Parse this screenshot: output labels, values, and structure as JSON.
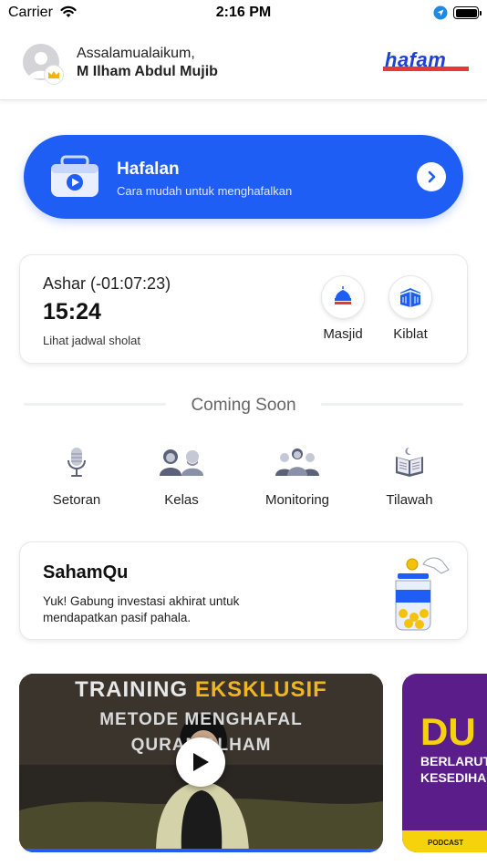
{
  "status_bar": {
    "carrier": "Carrier",
    "time": "2:16 PM"
  },
  "header": {
    "greeting": "Assalamualaikum,",
    "username": "M Ilham Abdul Mujib",
    "logo_text": "hafam"
  },
  "hafalan": {
    "title": "Hafalan",
    "subtitle": "Cara mudah untuk menghafalkan"
  },
  "prayer": {
    "name": "Ashar (-01:07:23)",
    "time": "15:24",
    "schedule_link": "Lihat jadwal sholat",
    "buttons": [
      {
        "label": "Masjid",
        "icon": "mosque-icon"
      },
      {
        "label": "Kiblat",
        "icon": "kaaba-icon"
      }
    ]
  },
  "coming_soon": {
    "title": "Coming Soon",
    "features": [
      {
        "label": "Setoran",
        "icon": "microphone-icon"
      },
      {
        "label": "Kelas",
        "icon": "class-icon"
      },
      {
        "label": "Monitoring",
        "icon": "group-icon"
      },
      {
        "label": "Tilawah",
        "icon": "quran-book-icon"
      }
    ]
  },
  "saham": {
    "title": "SahamQu",
    "description": "Yuk! Gabung investasi akhirat untuk mendapatkan pasif pahala."
  },
  "videos": {
    "training": {
      "line1_a": "TRAINING",
      "line1_b": "EKSKLUSIF",
      "line2": "METODE MENGHAFAL",
      "line3": "QURAN ALHAM"
    },
    "podcast": {
      "big": "DU",
      "line1": "BERLARUT",
      "line2": "KESEDIHA",
      "tag": "PODCAST"
    }
  },
  "colors": {
    "accent": "#1f5ef5",
    "logo_red": "#e53935"
  }
}
